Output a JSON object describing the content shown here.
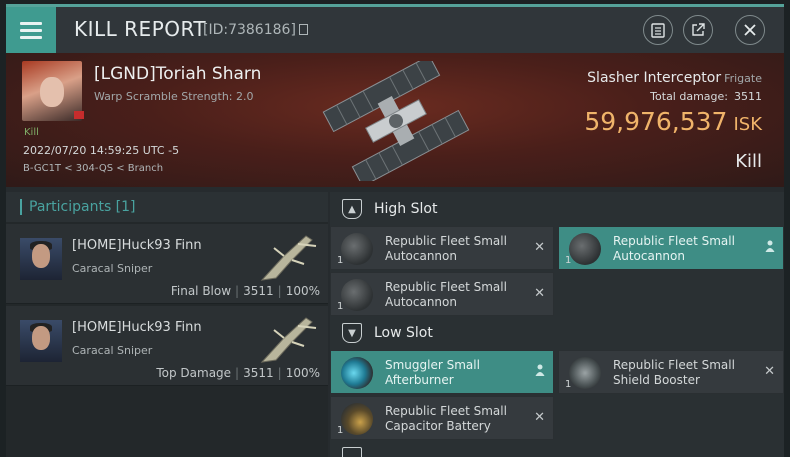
{
  "header": {
    "title": "KILL REPORT",
    "kill_id": "[ID:7386186]"
  },
  "victim": {
    "pilot": "[LGND]Toriah Sharn",
    "scramble": "Warp Scramble Strength: 2.0",
    "tag": "Kill",
    "datetime": "2022/07/20 14:59:25 UTC -5",
    "location": "B-GC1T < 304-QS < Branch",
    "ship": "Slasher Interceptor",
    "ship_class": "Frigate",
    "total_damage_label": "Total damage:",
    "total_damage": "3511",
    "isk_value": "59,976,537",
    "isk_currency": "ISK",
    "result": "Kill"
  },
  "participants": {
    "header": "Participants [1]",
    "rows": [
      {
        "name": "[HOME]Huck93 Finn",
        "ship": "Caracal Sniper",
        "role": "Final Blow",
        "damage": "3511",
        "percent": "100%"
      },
      {
        "name": "[HOME]Huck93 Finn",
        "ship": "Caracal Sniper",
        "role": "Top Damage",
        "damage": "3511",
        "percent": "100%"
      }
    ]
  },
  "fitting": {
    "high_slot": {
      "title": "High Slot",
      "items": [
        {
          "qty": "1",
          "name_line1": "Republic Fleet Small",
          "name_line2": "Autocannon",
          "state": "destroyed",
          "icon": "autocannon-icon"
        },
        {
          "qty": "1",
          "name_line1": "Republic Fleet Small",
          "name_line2": "Autocannon",
          "state": "dropped",
          "icon": "autocannon-icon"
        },
        {
          "qty": "1",
          "name_line1": "Republic Fleet Small",
          "name_line2": "Autocannon",
          "state": "destroyed",
          "icon": "autocannon-icon"
        }
      ]
    },
    "low_slot": {
      "title": "Low Slot",
      "items": [
        {
          "qty": "",
          "name_line1": "Smuggler Small",
          "name_line2": "Afterburner",
          "state": "dropped",
          "icon": "afterburner-icon"
        },
        {
          "qty": "1",
          "name_line1": "Republic Fleet Small",
          "name_line2": "Shield Booster",
          "state": "destroyed",
          "icon": "shield-booster-icon"
        },
        {
          "qty": "1",
          "name_line1": "Republic Fleet Small",
          "name_line2": "Capacitor Battery",
          "state": "destroyed",
          "icon": "capacitor-battery-icon"
        }
      ]
    },
    "destroyed_glyph": "✕"
  },
  "colors": {
    "accent": "#3f9b90",
    "isk": "#f0b46a",
    "highlight_item": "#3e8d85"
  }
}
